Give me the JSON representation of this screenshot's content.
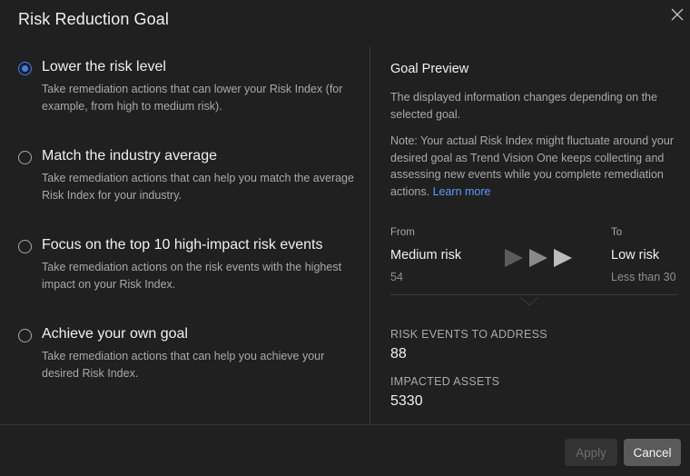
{
  "dialog": {
    "title": "Risk Reduction Goal",
    "close_icon": "close-icon"
  },
  "options": [
    {
      "label": "Lower the risk level",
      "description": "Take remediation actions that can lower your Risk Index (for example, from high to medium risk).",
      "selected": true
    },
    {
      "label": "Match the industry average",
      "description": "Take remediation actions that can help you match the average Risk Index for your industry.",
      "selected": false
    },
    {
      "label": "Focus on the top 10 high-impact risk events",
      "description": "Take remediation actions on the risk events with the highest impact on your Risk Index.",
      "selected": false
    },
    {
      "label": "Achieve your own goal",
      "description": "Take remediation actions that can help you achieve your desired Risk Index.",
      "selected": false
    }
  ],
  "preview": {
    "title": "Goal Preview",
    "text1": "The displayed information changes depending on the selected goal.",
    "text2": "Note: Your actual Risk Index might fluctuate around your desired goal as Trend Vision One keeps collecting and assessing new events while you complete remediation actions.",
    "learn_more": "Learn more",
    "from": {
      "caption": "From",
      "value": "Medium risk",
      "sub": "54"
    },
    "to": {
      "caption": "To",
      "value": "Low risk",
      "sub": "Less than 30"
    },
    "arrow_icon": "triple-arrow-icon"
  },
  "stats": {
    "risk_events_label": "RISK EVENTS TO ADDRESS",
    "risk_events_value": "88",
    "impacted_assets_label": "IMPACTED ASSETS",
    "impacted_assets_value": "5330"
  },
  "footer": {
    "apply_label": "Apply",
    "cancel_label": "Cancel"
  },
  "colors": {
    "background": "#202020",
    "accent": "#3d7df6",
    "link": "#5a9cf8"
  }
}
